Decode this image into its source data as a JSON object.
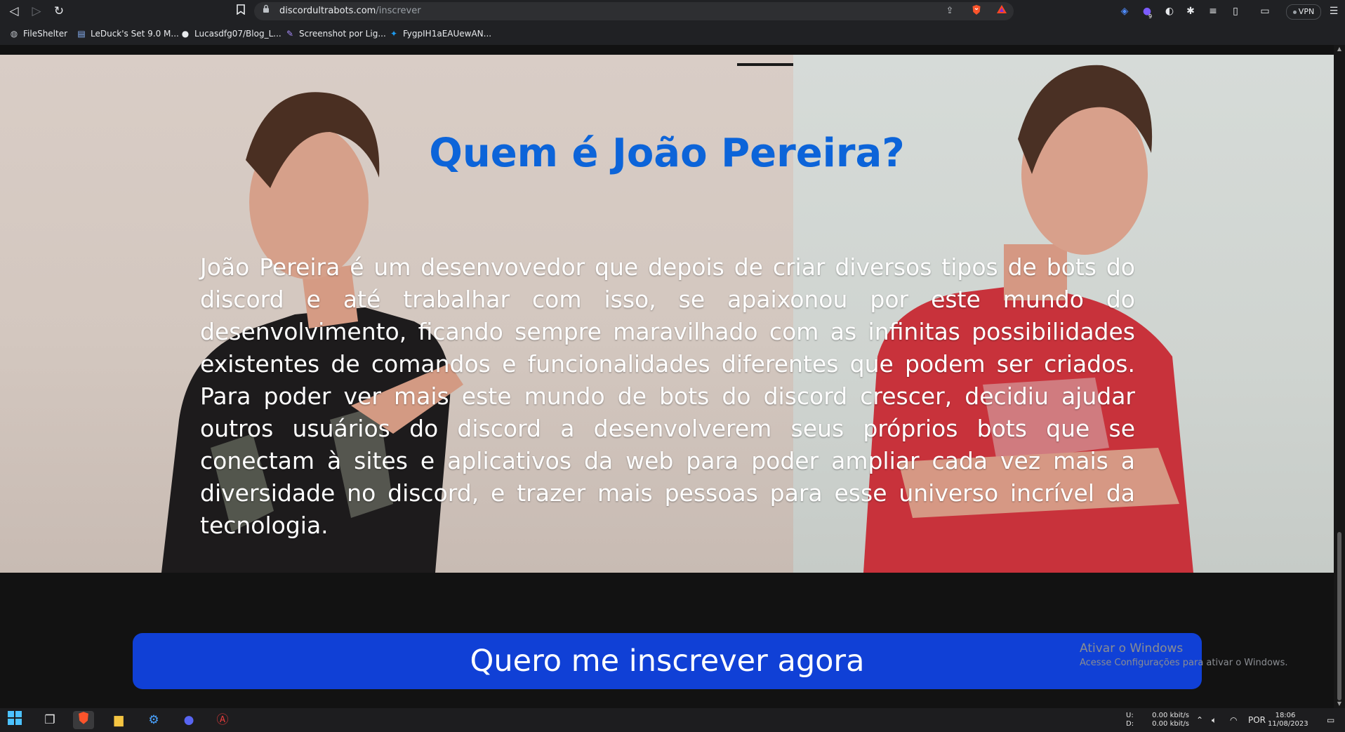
{
  "browser": {
    "url_domain": "discordultrabots.com",
    "url_path": "/inscrever",
    "vpn_label": "VPN",
    "extension_badge": "9",
    "bookmarks": [
      {
        "label": "FileShelter",
        "icon": "globe-icon"
      },
      {
        "label": "LeDuck's Set 9.0 M...",
        "icon": "duck-icon"
      },
      {
        "label": "Lucasdfg07/Blog_L...",
        "icon": "github-icon"
      },
      {
        "label": "Screenshot por Lig...",
        "icon": "feather-icon"
      },
      {
        "label": "FygpIH1aEAUewAN...",
        "icon": "twitter-icon"
      }
    ]
  },
  "hero": {
    "title": "Quem é João Pereira?",
    "paragraph": "João Pereira é um desenvovedor que depois de criar diversos tipos de bots do discord e até trabalhar com isso, se apaixonou por este mundo do desenvolvimento, ficando sempre maravilhado com as infinitas possibilidades existentes de comandos e funcionalidades diferentes que podem ser criados. Para poder ver mais este mundo de bots do discord crescer, decidiu ajudar outros usuários do discord a desenvolverem seus próprios bots que se conectam à sites e aplicativos da web para poder ampliar cada vez mais a diversidade no discord, e trazer mais pessoas para esse universo incrível da tecnologia.",
    "title_color": "#0c64d9"
  },
  "cta": {
    "label": "Quero me inscrever agora",
    "color": "#1040d6"
  },
  "watermark": {
    "line1": "Ativar o Windows",
    "line2": "Acesse Configurações para ativar o Windows."
  },
  "taskbar": {
    "upload_label": "U:",
    "download_label": "D:",
    "upload_speed": "0.00 kbit/s",
    "download_speed": "0.00 kbit/s",
    "language": "POR",
    "time": "18:06",
    "date": "11/08/2023"
  }
}
